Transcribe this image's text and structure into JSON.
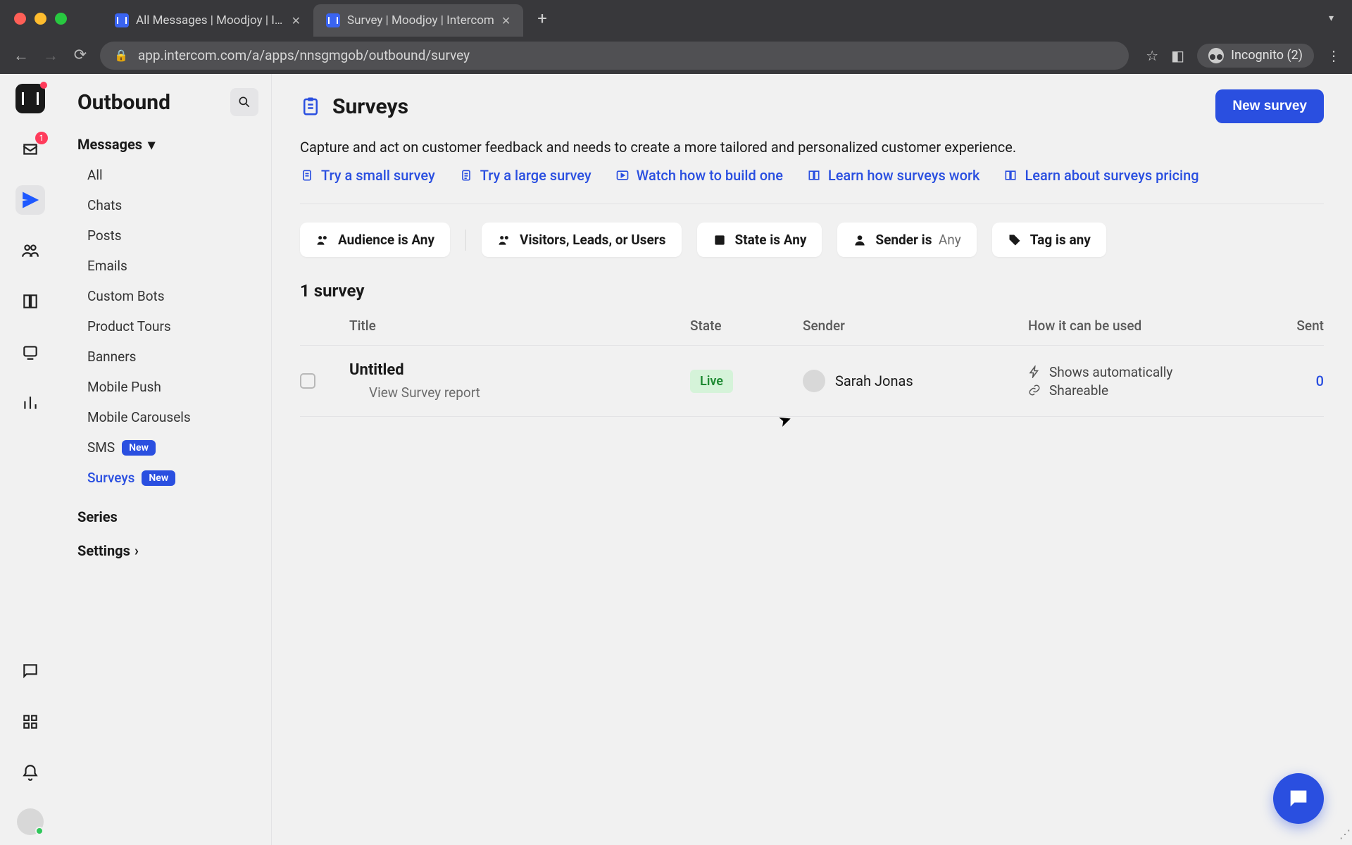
{
  "browser": {
    "tabs": [
      {
        "title": "All Messages | Moodjoy | Interc"
      },
      {
        "title": "Survey | Moodjoy | Intercom"
      }
    ],
    "url": "app.intercom.com/a/apps/nnsgmgob/outbound/survey",
    "incognitoLabel": "Incognito (2)"
  },
  "rail": {
    "inboxBadge": "1"
  },
  "sidebar": {
    "title": "Outbound",
    "messagesLabel": "Messages",
    "items": {
      "all": "All",
      "chats": "Chats",
      "posts": "Posts",
      "emails": "Emails",
      "customBots": "Custom Bots",
      "productTours": "Product Tours",
      "banners": "Banners",
      "mobilePush": "Mobile Push",
      "mobileCarousels": "Mobile Carousels",
      "sms": "SMS",
      "surveys": "Surveys"
    },
    "newBadge": "New",
    "series": "Series",
    "settings": "Settings"
  },
  "page": {
    "title": "Surveys",
    "newButton": "New survey",
    "description": "Capture and act on customer feedback and needs to create a more tailored and personalized customer experience.",
    "help": {
      "small": "Try a small survey",
      "large": "Try a large survey",
      "watch": "Watch how to build one",
      "learnHow": "Learn how surveys work",
      "pricing": "Learn about surveys pricing"
    },
    "filters": {
      "audiencePrefix": "Audience is",
      "audienceValue": "Any",
      "visitors": "Visitors, Leads, or Users",
      "statePrefix": "State is",
      "stateValue": "Any",
      "senderPrefix": "Sender is",
      "senderValue": "Any",
      "tagPrefix": "Tag is",
      "tagValue": "any"
    },
    "countLabel": "1 survey",
    "columns": {
      "title": "Title",
      "state": "State",
      "sender": "Sender",
      "usage": "How it can be used",
      "sent": "Sent"
    },
    "rows": [
      {
        "title": "Untitled",
        "reportLink": "View Survey report",
        "state": "Live",
        "sender": "Sarah Jonas",
        "usageA": "Shows automatically",
        "usageB": "Shareable",
        "sent": "0"
      }
    ]
  }
}
